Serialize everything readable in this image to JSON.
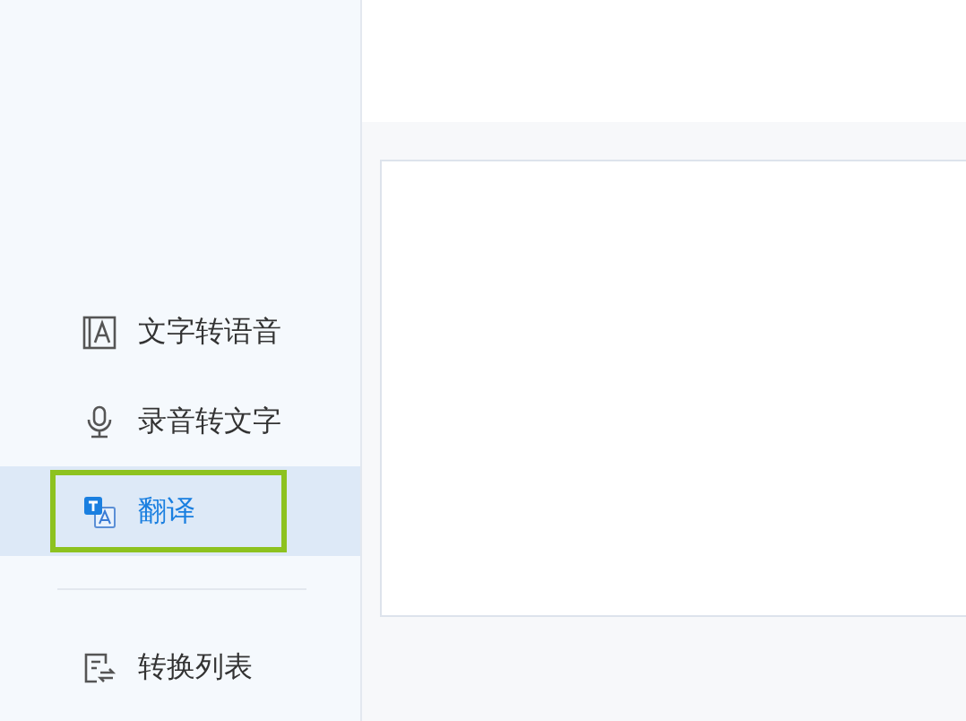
{
  "sidebar": {
    "items": [
      {
        "kind": "text-to-speech",
        "label": "文字转语音",
        "selected": false,
        "highlighted": false
      },
      {
        "kind": "speech-to-text",
        "label": "录音转文字",
        "selected": false,
        "highlighted": false
      },
      {
        "kind": "translate",
        "label": "翻译",
        "selected": true,
        "highlighted": true
      },
      {
        "kind": "divider"
      },
      {
        "kind": "convert-list",
        "label": "转换列表",
        "selected": false,
        "highlighted": false
      }
    ]
  }
}
